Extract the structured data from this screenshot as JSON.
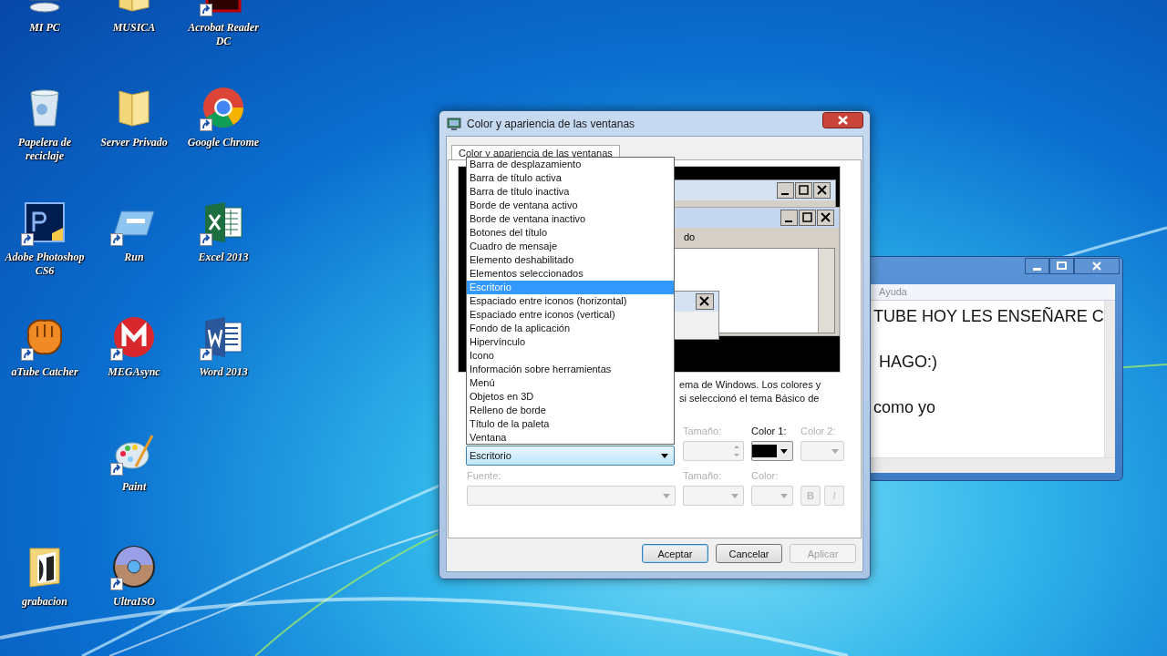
{
  "desktop": {
    "icons": [
      {
        "label": "MI PC",
        "kind": "computer",
        "shortcut": false
      },
      {
        "label": "MUSICA",
        "kind": "folder",
        "shortcut": false
      },
      {
        "label": "Acrobat Reader DC",
        "kind": "pdf",
        "shortcut": true
      },
      {
        "label": "Papelera de reciclaje",
        "kind": "recycle",
        "shortcut": false
      },
      {
        "label": "Server Privado",
        "kind": "folder",
        "shortcut": false
      },
      {
        "label": "Google Chrome",
        "kind": "chrome",
        "shortcut": true
      },
      {
        "label": "Adobe Photoshop CS6",
        "kind": "photoshop",
        "shortcut": true
      },
      {
        "label": "Run",
        "kind": "run",
        "shortcut": true
      },
      {
        "label": "Excel 2013",
        "kind": "excel",
        "shortcut": true
      },
      {
        "label": "aTube Catcher",
        "kind": "mitt",
        "shortcut": true
      },
      {
        "label": "MEGAsync",
        "kind": "mega",
        "shortcut": true
      },
      {
        "label": "Word 2013",
        "kind": "word",
        "shortcut": true
      },
      {
        "label": "Paint",
        "kind": "paint",
        "shortcut": true
      },
      {
        "label": "grabacion",
        "kind": "media-folder",
        "shortcut": false
      },
      {
        "label": "UltraISO",
        "kind": "disc",
        "shortcut": true
      }
    ]
  },
  "notepad": {
    "menu": [
      "Ayuda"
    ],
    "lines": [
      "TUBE HOY LES ENSEÑARE C",
      "HAGO:)",
      "como yo"
    ]
  },
  "dialog": {
    "title": "Color y apariencia de las ventanas",
    "tabs": [
      {
        "label": "Color y apariencia de las ventanas",
        "selected": true
      }
    ],
    "preview": {
      "menu_fragment": "do"
    },
    "description_lines": [
      "ema de Windows.  Los colores y",
      "si seleccionó el tema Básico de"
    ],
    "dropdown": {
      "value": "Escritorio",
      "expanded": true,
      "options": [
        {
          "label": "Barra de desplazamiento",
          "selected": false
        },
        {
          "label": "Barra de título activa",
          "selected": false
        },
        {
          "label": "Barra de título inactiva",
          "selected": false
        },
        {
          "label": "Borde de ventana activo",
          "selected": false
        },
        {
          "label": "Borde de ventana inactivo",
          "selected": false
        },
        {
          "label": "Botones del título",
          "selected": false
        },
        {
          "label": "Cuadro de mensaje",
          "selected": false
        },
        {
          "label": "Elemento deshabilitado",
          "selected": false
        },
        {
          "label": "Elementos seleccionados",
          "selected": false
        },
        {
          "label": "Escritorio",
          "selected": true
        },
        {
          "label": "Espaciado entre iconos (horizontal)",
          "selected": false
        },
        {
          "label": "Espaciado entre iconos (vertical)",
          "selected": false
        },
        {
          "label": "Fondo de la aplicación",
          "selected": false
        },
        {
          "label": "Hipervínculo",
          "selected": false
        },
        {
          "label": "Icono",
          "selected": false
        },
        {
          "label": "Información sobre herramientas",
          "selected": false
        },
        {
          "label": "Menú",
          "selected": false
        },
        {
          "label": "Objetos en 3D",
          "selected": false
        },
        {
          "label": "Relleno de borde",
          "selected": false
        },
        {
          "label": "Título de la paleta",
          "selected": false
        },
        {
          "label": "Ventana",
          "selected": false
        }
      ]
    },
    "item_row": {
      "size": {
        "label": "Tamaño:",
        "disabled": true
      },
      "color1": {
        "label": "Color 1:",
        "disabled": false,
        "color": "#000000"
      },
      "color2": {
        "label": "Color 2:",
        "disabled": true
      }
    },
    "font_row": {
      "font": {
        "label": "Fuente:",
        "disabled": true
      },
      "size": {
        "label": "Tamaño:",
        "disabled": true
      },
      "color": {
        "label": "Color:",
        "disabled": true
      },
      "bold": {
        "label": "B",
        "disabled": true
      },
      "italic": {
        "label": "I",
        "disabled": true
      }
    },
    "buttons": [
      {
        "label": "Aceptar",
        "default": true,
        "disabled": false
      },
      {
        "label": "Cancelar",
        "default": false,
        "disabled": false
      },
      {
        "label": "Aplicar",
        "default": false,
        "disabled": true
      }
    ]
  }
}
